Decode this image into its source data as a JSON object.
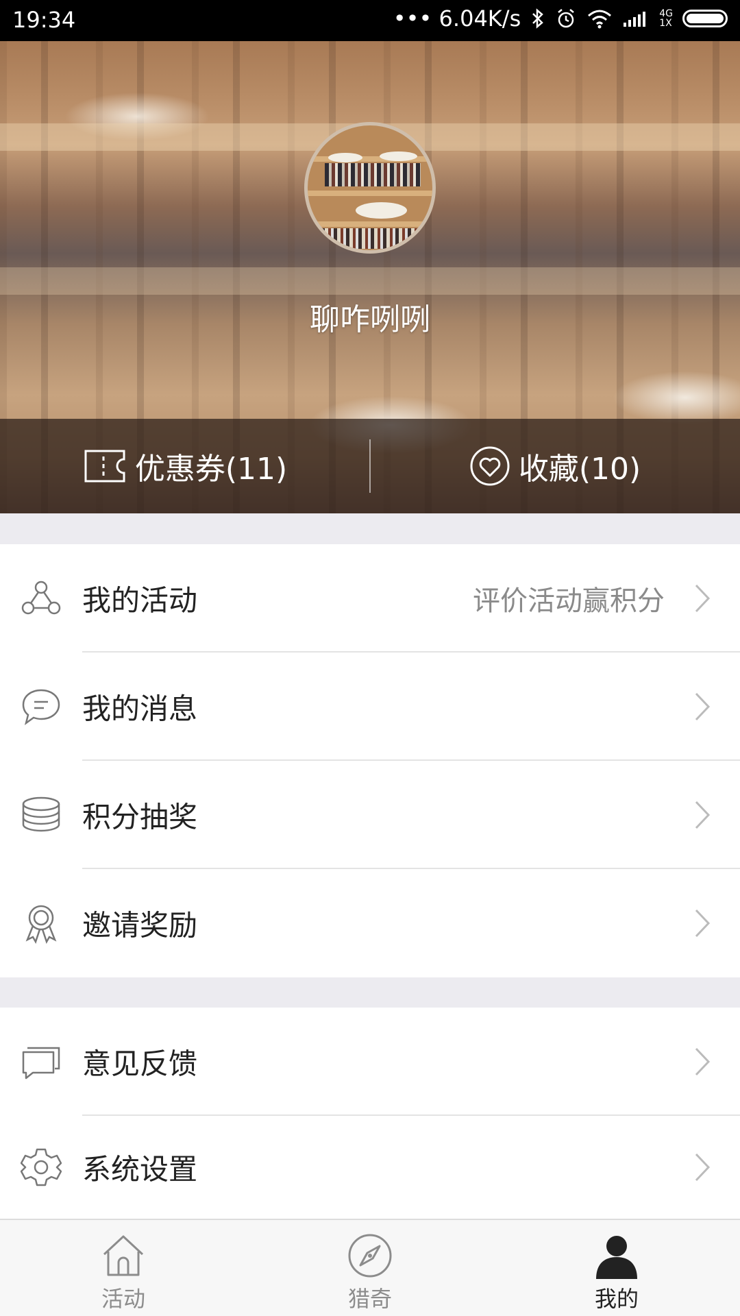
{
  "status_bar": {
    "time": "19:34",
    "network_speed": "••• 6.04K/s",
    "signal_top": "4G",
    "signal_bottom": "1X",
    "icons": [
      "bluetooth-icon",
      "alarm-icon",
      "wifi-icon",
      "signal-icon",
      "battery-icon"
    ]
  },
  "profile": {
    "username": "聊咋咧咧",
    "coupons_label": "优惠券(11)",
    "favorites_label": "收藏(10)"
  },
  "menu_group_1": [
    {
      "label": "我的活动",
      "hint": "评价活动赢积分",
      "icon": "activity-nodes-icon"
    },
    {
      "label": "我的消息",
      "hint": "",
      "icon": "chat-bubble-icon"
    },
    {
      "label": "积分抽奖",
      "hint": "",
      "icon": "coin-stack-icon"
    },
    {
      "label": "邀请奖励",
      "hint": "",
      "icon": "award-ribbon-icon"
    }
  ],
  "menu_group_2": [
    {
      "label": "意见反馈",
      "hint": "",
      "icon": "feedback-icon"
    },
    {
      "label": "系统设置",
      "hint": "",
      "icon": "settings-gear-icon"
    }
  ],
  "tabbar": [
    {
      "label": "活动",
      "icon": "home-icon",
      "active": false
    },
    {
      "label": "猎奇",
      "icon": "compass-icon",
      "active": false
    },
    {
      "label": "我的",
      "icon": "person-icon",
      "active": true
    }
  ],
  "colors": {
    "background": "#ecebf0",
    "text_primary": "#222222",
    "text_secondary": "#8a8a8a",
    "tab_inactive": "#8c8c8c"
  }
}
